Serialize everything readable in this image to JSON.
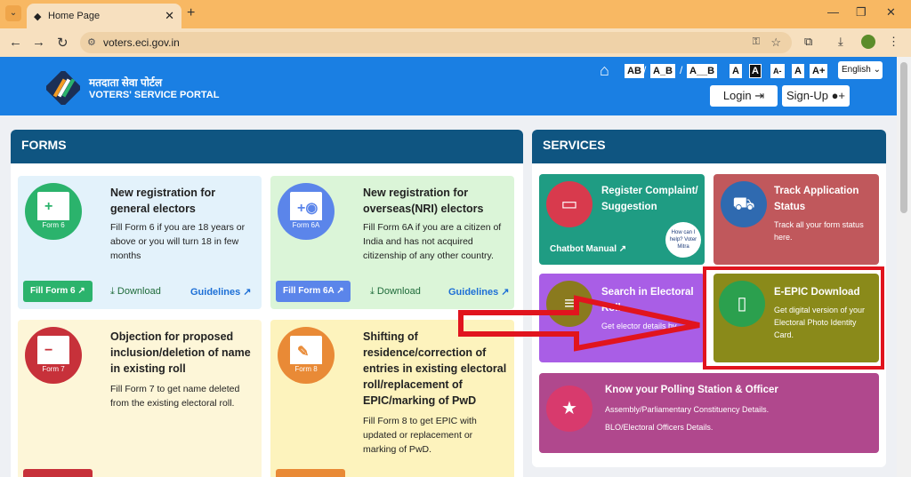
{
  "browser": {
    "tab_title": "Home Page",
    "url": "voters.eci.gov.in"
  },
  "header": {
    "brand_hindi": "मतदाता सेवा पोर्टल",
    "brand_english": "VOTERS' SERVICE PORTAL",
    "format_options": [
      "AB",
      "A_B",
      "A__B"
    ],
    "size_options": [
      "A",
      "A",
      "A-",
      "A",
      "A+"
    ],
    "language": "English",
    "login_label": "Login",
    "signup_label": "Sign-Up"
  },
  "forms": {
    "heading": "FORMS",
    "cards": [
      {
        "form_label": "Form 6",
        "title": "New registration for general electors",
        "desc": "Fill Form 6 if you are 18 years or above or you will turn 18 in few months",
        "fill_label": "Fill Form 6",
        "download_label": "Download",
        "guidelines_label": "Guidelines",
        "colors": {
          "bg": "#e3f2fb",
          "circle": "#2bb36c",
          "accent": "#2bb36c"
        }
      },
      {
        "form_label": "Form 6A",
        "title": "New registration for overseas(NRI) electors",
        "desc": "Fill Form 6A if you are a citizen of India and has not acquired citizenship of any other country.",
        "fill_label": "Fill Form 6A",
        "download_label": "Download",
        "guidelines_label": "Guidelines",
        "colors": {
          "bg": "#dbf5d8",
          "circle": "#5b85ea",
          "accent": "#5b85ea"
        }
      },
      {
        "form_label": "Form 7",
        "title": "Objection for proposed inclusion/deletion of name in existing roll",
        "desc": "Fill Form 7 to get name deleted from the existing electoral roll.",
        "colors": {
          "bg": "#fdf6d8",
          "circle": "#c7313a",
          "accent": "#c7313a"
        }
      },
      {
        "form_label": "Form 8",
        "title": "Shifting of residence/correction of entries in existing electoral roll/replacement of EPIC/marking of PwD",
        "desc": "Fill Form 8 to get EPIC with updated or replacement or marking of PwD.",
        "colors": {
          "bg": "#fdf3bd",
          "circle": "#e98a36",
          "accent": "#e98a36"
        }
      }
    ]
  },
  "services": {
    "heading": "SERVICES",
    "cards": [
      {
        "title": "Register Complaint/ Suggestion",
        "desc": "",
        "link": "Chatbot Manual",
        "badge": "How can I help? Voter Mitra",
        "colors": {
          "bg": "#1f9c83",
          "circle": "#d83a4d"
        }
      },
      {
        "title": "Track Application Status",
        "desc": "Track all your form status here.",
        "colors": {
          "bg": "#c0585c",
          "circle": "#2f6ab0"
        }
      },
      {
        "title": "Search in Electoral Roll",
        "desc": "Get elector details by",
        "colors": {
          "bg": "#a95ee6",
          "circle": "#8a7a1e"
        }
      },
      {
        "title": "E-EPIC Download",
        "desc": "Get digital version of your Electoral Photo Identity Card.",
        "colors": {
          "bg": "#8a8a1a",
          "circle": "#2ba04e"
        }
      },
      {
        "title": "Know your Polling Station & Officer",
        "desc": "Assembly/Parliamentary Constituency Details.",
        "desc2": "BLO/Electoral Officers Details.",
        "colors": {
          "bg": "#b0488d",
          "circle": "#d83a6d"
        }
      }
    ]
  },
  "colors": {
    "header": "#1a7fe3",
    "panel_head": "#0f5581",
    "highlight": "#e1141e"
  }
}
